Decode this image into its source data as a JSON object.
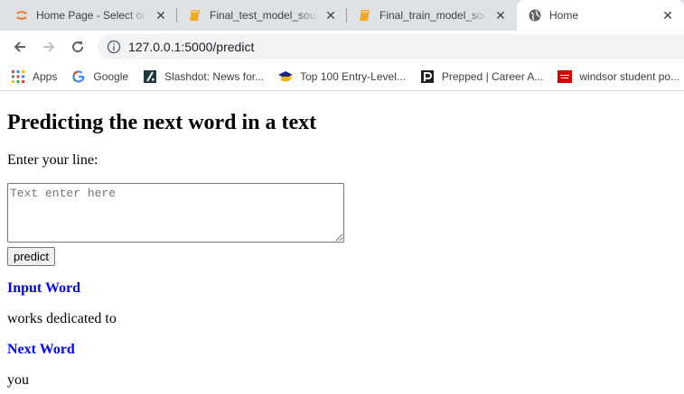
{
  "browser": {
    "tabs": [
      {
        "title": "Home Page - Select or create a notebook",
        "icon": "jupyter-icon"
      },
      {
        "title": "Final_test_model_source.ipynb",
        "icon": "notebook-icon"
      },
      {
        "title": "Final_train_model_source.ipynb",
        "icon": "notebook-icon"
      },
      {
        "title": "Home",
        "icon": "globe-icon",
        "active": true
      }
    ],
    "address": "127.0.0.1:5000/predict",
    "bookmarks": [
      {
        "label": "Apps",
        "icon": "apps-grid-icon"
      },
      {
        "label": "Google",
        "icon": "google-icon"
      },
      {
        "label": "Slashdot: News for...",
        "icon": "slashdot-icon"
      },
      {
        "label": "Top 100 Entry-Level...",
        "icon": "graduation-cap-icon"
      },
      {
        "label": "Prepped | Career A...",
        "icon": "prepped-icon"
      },
      {
        "label": "windsor student po...",
        "icon": "windsor-icon"
      }
    ]
  },
  "page": {
    "title": "Predicting the next word in a text",
    "prompt_label": "Enter your line:",
    "textarea_placeholder": "Text enter here",
    "button_label": "predict",
    "input_heading": "Input Word",
    "input_value": "works dedicated to",
    "next_heading": "Next Word",
    "next_value": "you"
  },
  "colors": {
    "heading_blue": "#0000ff",
    "tabstrip": "#dee1e6"
  }
}
